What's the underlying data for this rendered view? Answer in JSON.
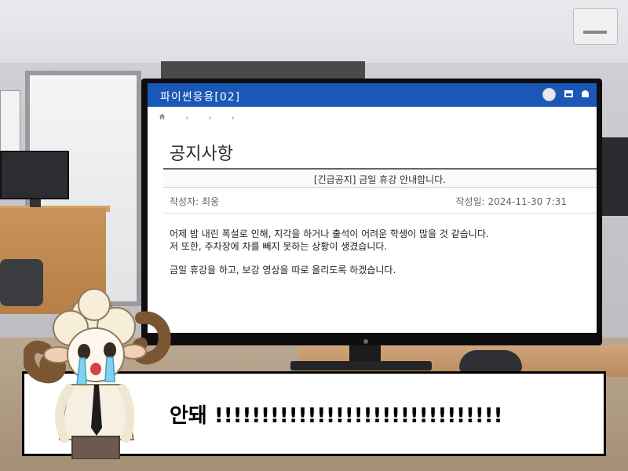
{
  "lms": {
    "course_title": "파이썬응용[02]",
    "page_title": "공지사항",
    "breadcrumb": [
      "›",
      "›",
      "›"
    ],
    "notice": {
      "subject": "[긴급공지] 금일 휴강 안내합니다.",
      "author": "작성자: 최웅",
      "date": "작성일: 2024-11-30 7:31",
      "body_lines": [
        "어제 밤 내린 폭설로 인해, 지각을 하거나 출석이 어려운 학생이 많을 것 같습니다.",
        "저 또한, 주차장에 차를 빼지 못하는 상황이 생겼습니다.",
        "금일 휴강을 하고, 보강 영상을 따로 올리도록 하겠습니다."
      ]
    },
    "colors": {
      "topbar": "#1a57b6"
    },
    "icons": [
      "home-icon",
      "user-avatar-icon",
      "message-icon",
      "bell-icon"
    ]
  },
  "caption": {
    "text": "안돼 !!!!!!!!!!!!!!!!!!!!!!!!!!!!!!!"
  }
}
